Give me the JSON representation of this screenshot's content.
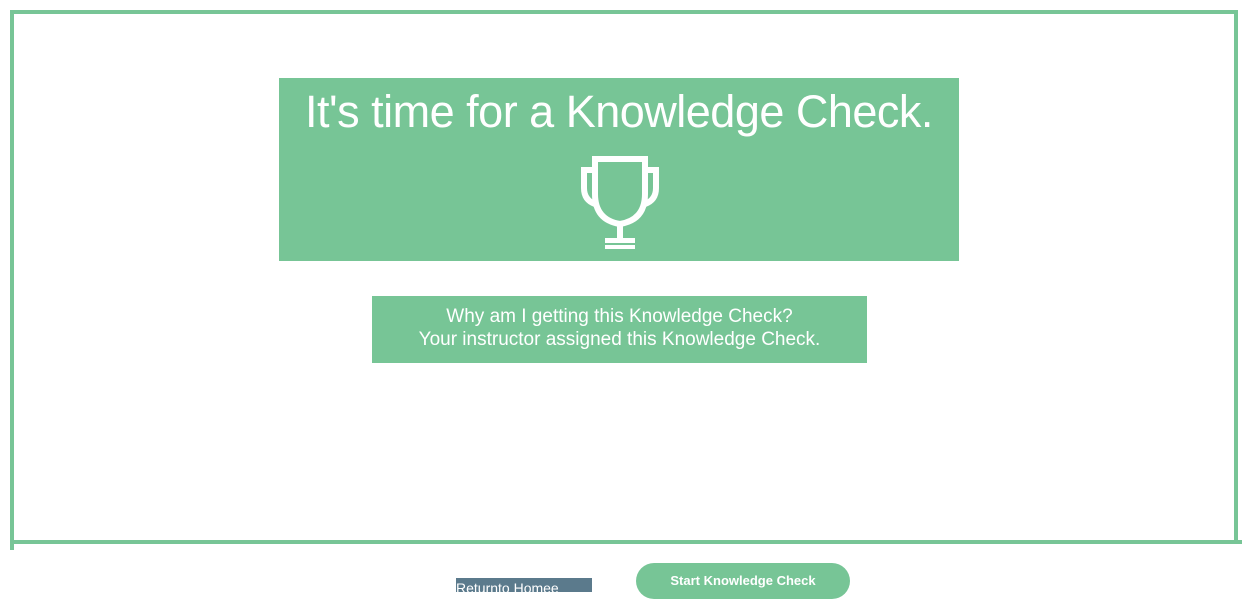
{
  "hero": {
    "title": "It's time for a Knowledge Check.",
    "icon": "trophy-icon"
  },
  "info": {
    "question": "Why am I getting this Knowledge Check?",
    "answer": "Your instructor assigned this Knowledge Check."
  },
  "actions": {
    "return_label": "Returnto Homee",
    "start_label": "Start Knowledge Check"
  },
  "colors": {
    "accent": "#77c596",
    "link_bg": "#5b7a8c",
    "text_on_accent": "#ffffff"
  }
}
